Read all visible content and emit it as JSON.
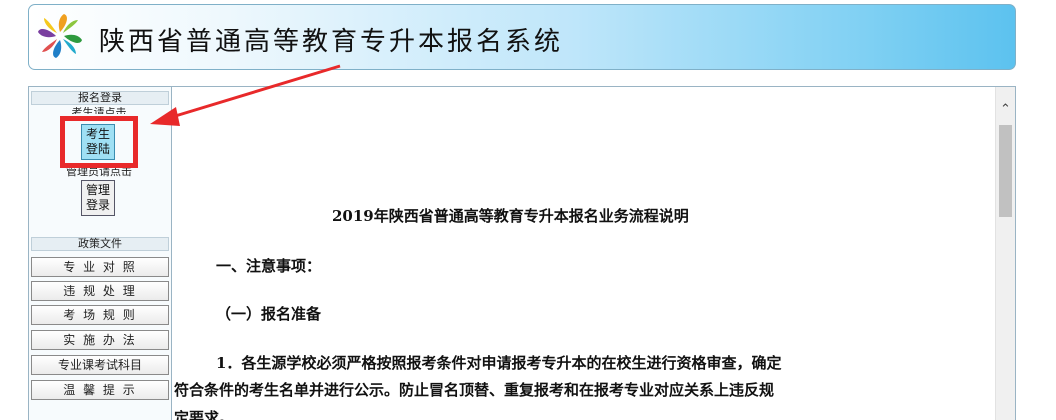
{
  "banner": {
    "title": "陕西省普通高等教育专升本报名系统"
  },
  "sidebar": {
    "login_header": "报名登录",
    "student_hint": "考生请点击",
    "student_button": "考生\n登陆",
    "admin_hint": "管理员请点击",
    "admin_button": "管理\n登录",
    "policy_header": "政策文件",
    "policy_items": [
      "专 业 对 照",
      "违 规 处 理",
      "考 场 规 则",
      "实 施 办 法",
      "专业课考试科目",
      "温 馨 提 示"
    ]
  },
  "content": {
    "title": "2019年陕西省普通高等教育专升本报名业务流程说明",
    "section1": "一、注意事项：",
    "section2": "（一）报名准备",
    "item1": "1．各生源学校必须严格按照报考条件对申请报考专升本的在校生进行资格审查，确定",
    "item1_cont": "符合条件的考生名单并进行公示。防止冒名顶替、重复报考和在报考专业对应关系上违反规",
    "item1_cont2": "定要求。"
  },
  "annotation": {
    "color": "#e8292a"
  }
}
